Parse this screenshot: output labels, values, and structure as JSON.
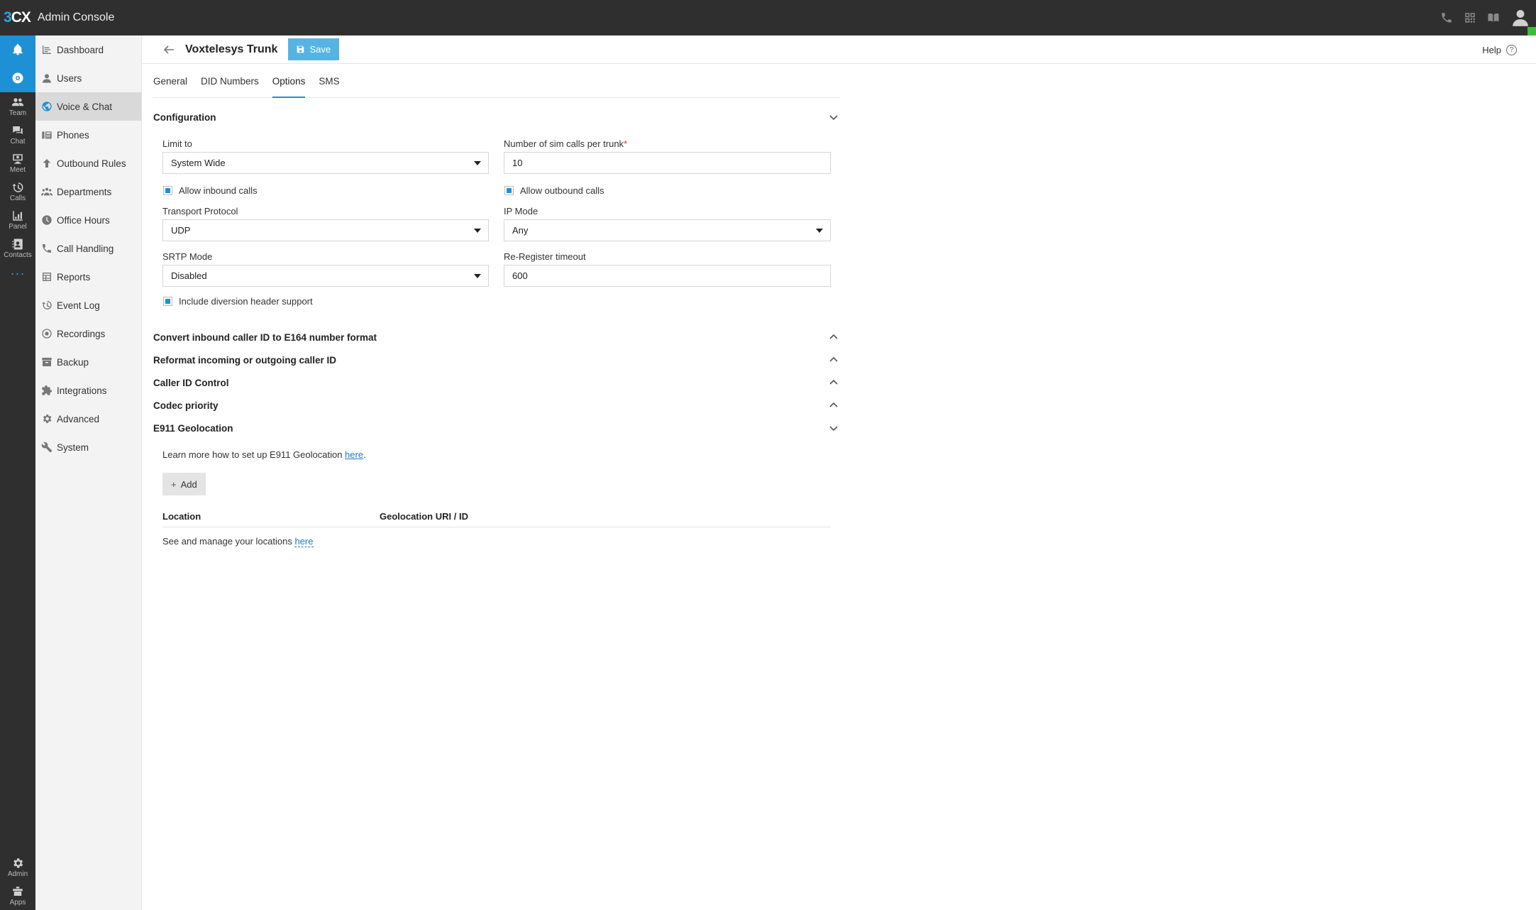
{
  "app": {
    "logo_three": "3",
    "logo_cx": "CX",
    "title": "Admin Console"
  },
  "top_icons": [
    "phone-icon",
    "qr-code-icon",
    "book-icon"
  ],
  "rail": {
    "items": [
      {
        "name": "bell-icon",
        "label": ""
      },
      {
        "name": "chrome-icon",
        "label": ""
      },
      {
        "name": "team-icon",
        "label": "Team"
      },
      {
        "name": "chat-icon",
        "label": "Chat"
      },
      {
        "name": "meet-icon",
        "label": "Meet"
      },
      {
        "name": "calls-icon",
        "label": "Calls"
      },
      {
        "name": "panel-icon",
        "label": "Panel"
      },
      {
        "name": "contacts-icon",
        "label": "Contacts"
      }
    ],
    "more": "···",
    "bottom": [
      {
        "name": "admin-gear-icon",
        "label": "Admin"
      },
      {
        "name": "apps-icon",
        "label": "Apps"
      }
    ]
  },
  "sidebar": {
    "items": [
      {
        "label": "Dashboard"
      },
      {
        "label": "Users"
      },
      {
        "label": "Voice & Chat"
      },
      {
        "label": "Phones"
      },
      {
        "label": "Outbound Rules"
      },
      {
        "label": "Departments"
      },
      {
        "label": "Office Hours"
      },
      {
        "label": "Call Handling"
      },
      {
        "label": "Reports"
      },
      {
        "label": "Event Log"
      },
      {
        "label": "Recordings"
      },
      {
        "label": "Backup"
      },
      {
        "label": "Integrations"
      },
      {
        "label": "Advanced"
      },
      {
        "label": "System"
      }
    ]
  },
  "header": {
    "title": "Voxtelesys Trunk",
    "save_label": "Save",
    "help_label": "Help",
    "help_q": "?"
  },
  "tabs": [
    {
      "label": "General"
    },
    {
      "label": "DID Numbers"
    },
    {
      "label": "Options"
    },
    {
      "label": "SMS"
    }
  ],
  "configuration": {
    "title": "Configuration",
    "limit_to_label": "Limit to",
    "limit_to_value": "System Wide",
    "sim_calls_label": "Number of sim calls per trunk",
    "sim_calls_required": "*",
    "sim_calls_value": "10",
    "allow_inbound_label": "Allow inbound calls",
    "allow_outbound_label": "Allow outbound calls",
    "transport_label": "Transport Protocol",
    "transport_value": "UDP",
    "ip_mode_label": "IP Mode",
    "ip_mode_value": "Any",
    "srtp_label": "SRTP Mode",
    "srtp_value": "Disabled",
    "reregister_label": "Re-Register timeout",
    "reregister_value": "600",
    "diversion_label": "Include diversion header support"
  },
  "sections": {
    "e164": "Convert inbound caller ID to E164 number format",
    "reformat": "Reformat incoming or outgoing caller ID",
    "callerid": "Caller ID Control",
    "codec": "Codec priority",
    "e911": "E911 Geolocation"
  },
  "e911": {
    "learn_text": "Learn more how to set up E911 Geolocation ",
    "learn_link": "here",
    "learn_end": ".",
    "add_label": "Add",
    "add_plus": "+",
    "col_location": "Location",
    "col_geo": "Geolocation URI / ID",
    "manage_text": "See and manage your locations ",
    "manage_link": "here"
  },
  "colors": {
    "accent": "#1e90d6",
    "save_button": "#55b4e3",
    "topbar": "#2f2f2f",
    "presence": "#3dbb3d"
  }
}
